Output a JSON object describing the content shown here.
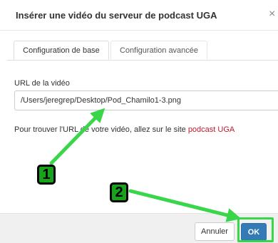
{
  "dialog": {
    "title": "Insérer une vidéo du serveur de podcast UGA",
    "close_glyph": "×"
  },
  "tabs": [
    {
      "label": "Configuration de base",
      "active": true
    },
    {
      "label": "Configuration avancée",
      "active": false
    }
  ],
  "form": {
    "url_label": "URL de la vidéo",
    "url_value": "/Users/jeregrep/Desktop/Pod_Chamilo1-3.png"
  },
  "help": {
    "text_before": "Pour trouver l'URL de votre vidéo, allez sur le site ",
    "link_text": "podcast UGA"
  },
  "footer": {
    "cancel_label": "Annuler",
    "ok_label": "OK"
  },
  "annotations": {
    "step1": "1",
    "step2": "2",
    "color": "#39d64a"
  }
}
